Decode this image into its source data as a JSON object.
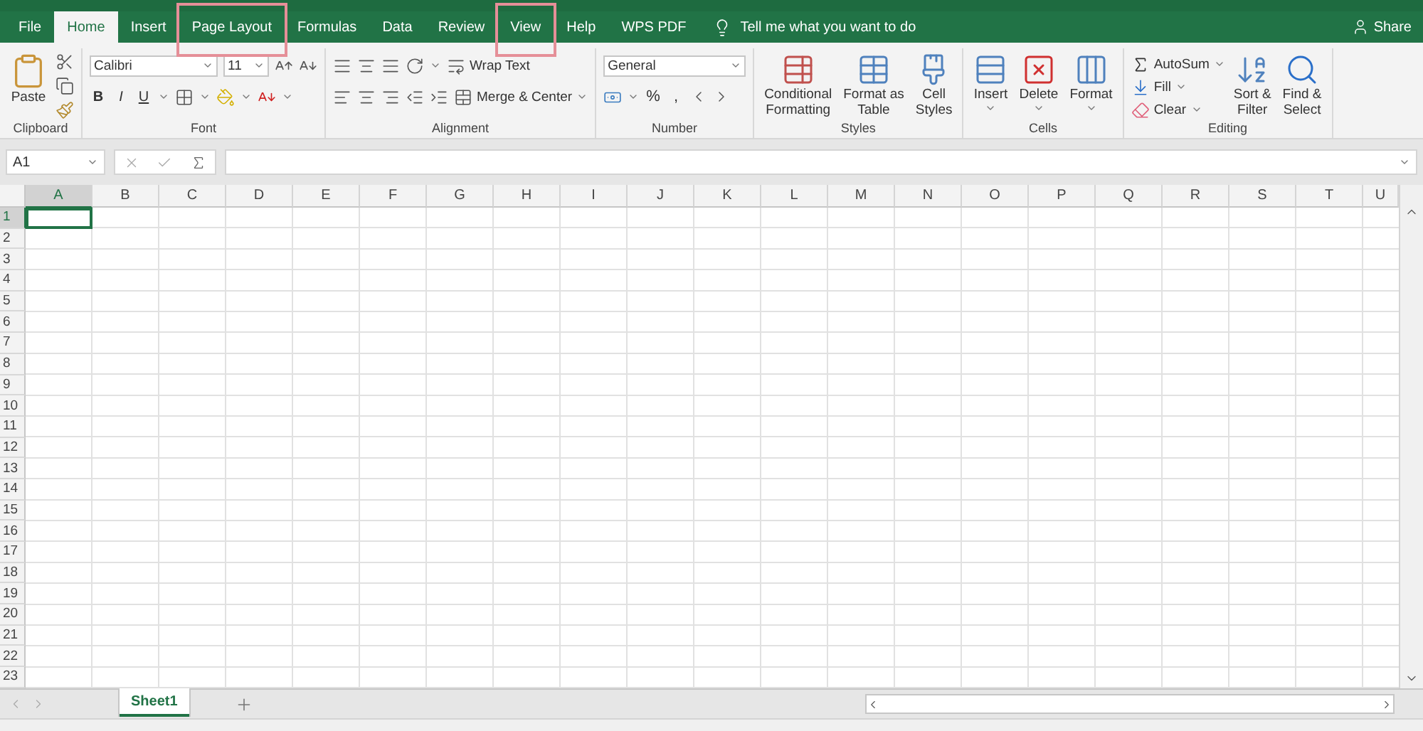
{
  "tabs": [
    {
      "label": "File",
      "selected": false,
      "highlighted": false
    },
    {
      "label": "Home",
      "selected": true,
      "highlighted": false
    },
    {
      "label": "Insert",
      "selected": false,
      "highlighted": false
    },
    {
      "label": "Page Layout",
      "selected": false,
      "highlighted": true
    },
    {
      "label": "Formulas",
      "selected": false,
      "highlighted": false
    },
    {
      "label": "Data",
      "selected": false,
      "highlighted": false
    },
    {
      "label": "Review",
      "selected": false,
      "highlighted": false
    },
    {
      "label": "View",
      "selected": false,
      "highlighted": true
    },
    {
      "label": "Help",
      "selected": false,
      "highlighted": false
    },
    {
      "label": "WPS PDF",
      "selected": false,
      "highlighted": false
    }
  ],
  "tell_me": "Tell me what you want to do",
  "share": "Share",
  "ribbon_groups": [
    {
      "kind": "clipboard",
      "title": "Clipboard",
      "paste": "Paste"
    },
    {
      "kind": "font",
      "title": "Font",
      "font_name": "Calibri",
      "font_size": "11",
      "bold": "B",
      "italic": "I",
      "underline": "U"
    },
    {
      "kind": "alignment",
      "title": "Alignment",
      "wrap": "Wrap Text",
      "merge": "Merge & Center"
    },
    {
      "kind": "number",
      "title": "Number",
      "format": "General",
      "percent": "%",
      "comma": ","
    },
    {
      "kind": "styles",
      "title": "Styles",
      "buttons": [
        "Conditional\nFormatting",
        "Format as\nTable",
        "Cell\nStyles"
      ]
    },
    {
      "kind": "cells",
      "title": "Cells",
      "buttons": [
        "Insert",
        "Delete",
        "Format"
      ]
    },
    {
      "kind": "editing",
      "title": "Editing",
      "autosum": "AutoSum",
      "fill": "Fill",
      "clear": "Clear",
      "buttons": [
        "Sort &\nFilter",
        "Find &\nSelect"
      ]
    }
  ],
  "name_box": "A1",
  "columns": [
    "A",
    "B",
    "C",
    "D",
    "E",
    "F",
    "G",
    "H",
    "I",
    "J",
    "K",
    "L",
    "M",
    "N",
    "O",
    "P",
    "Q",
    "R",
    "S",
    "T",
    "U"
  ],
  "rows": [
    "1",
    "2",
    "3",
    "4",
    "5",
    "6",
    "7",
    "8",
    "9",
    "10",
    "11",
    "12",
    "13",
    "14",
    "15",
    "16",
    "17",
    "18",
    "19",
    "20",
    "21",
    "22",
    "23"
  ],
  "sheets": [
    {
      "label": "Sheet1",
      "selected": true
    }
  ]
}
